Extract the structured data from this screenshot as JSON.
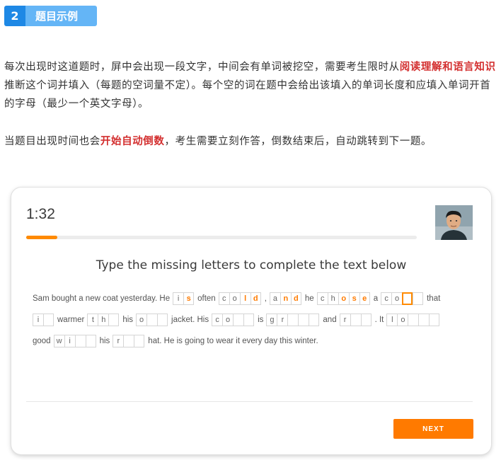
{
  "section": {
    "number": "2",
    "title": "题目示例"
  },
  "para1": {
    "before": "每次出现时这道题时，屏中会出现一段文字，中间会有单词被挖空，需要考生限时从",
    "highlight": "阅读理解和语言知识",
    "after": "推断这个词并填入（每题的空词量不定）。每个空的词在题中会给出该填入的单词长度和应填入单词开首的字母（最少一个英文字母）。"
  },
  "para2": {
    "before": "当题目出现时间也会",
    "highlight": "开始自动倒数",
    "after": "，考生需要立刻作答，倒数结束后，自动跳转到下一题。"
  },
  "colors": {
    "accent": "#ff8a00",
    "highlight": "#d32f2f",
    "badge": "#1e88e5"
  },
  "card": {
    "timer": "1:32",
    "progress_fraction": 0.08,
    "instruction": "Type the missing letters to complete the text below",
    "next_label": "NEXT",
    "lines": [
      [
        {
          "t": "Sam bought a new coat yesterday. He"
        },
        {
          "g": [
            {
              "c": "i",
              "s": "given"
            },
            {
              "c": "s",
              "s": "filled"
            }
          ]
        },
        {
          "t": "often"
        },
        {
          "g": [
            {
              "c": "c",
              "s": "given"
            },
            {
              "c": "o",
              "s": "given"
            },
            {
              "c": "l",
              "s": "filled"
            },
            {
              "c": "d",
              "s": "filled"
            }
          ]
        },
        {
          "t": ","
        },
        {
          "g": [
            {
              "c": "a",
              "s": "given"
            },
            {
              "c": "n",
              "s": "filled"
            },
            {
              "c": "d",
              "s": "filled"
            }
          ]
        },
        {
          "t": "he"
        },
        {
          "g": [
            {
              "c": "c",
              "s": "given"
            },
            {
              "c": "h",
              "s": "given"
            },
            {
              "c": "o",
              "s": "filled"
            },
            {
              "c": "s",
              "s": "filled"
            },
            {
              "c": "e",
              "s": "filled"
            }
          ]
        },
        {
          "t": "a"
        },
        {
          "g": [
            {
              "c": "c",
              "s": "given"
            },
            {
              "c": "o",
              "s": "given"
            },
            {
              "c": "",
              "s": "active"
            },
            {
              "c": "",
              "s": "empty"
            }
          ]
        },
        {
          "t": "that"
        }
      ],
      [
        {
          "g": [
            {
              "c": "i",
              "s": "given"
            },
            {
              "c": "",
              "s": "empty"
            }
          ]
        },
        {
          "t": "warmer"
        },
        {
          "g": [
            {
              "c": "t",
              "s": "given"
            },
            {
              "c": "h",
              "s": "given"
            },
            {
              "c": "",
              "s": "empty"
            }
          ]
        },
        {
          "t": "his"
        },
        {
          "g": [
            {
              "c": "o",
              "s": "given"
            },
            {
              "c": "",
              "s": "empty"
            },
            {
              "c": "",
              "s": "empty"
            }
          ]
        },
        {
          "t": "jacket. His"
        },
        {
          "g": [
            {
              "c": "c",
              "s": "given"
            },
            {
              "c": "o",
              "s": "given"
            },
            {
              "c": "",
              "s": "empty"
            },
            {
              "c": "",
              "s": "empty"
            }
          ]
        },
        {
          "t": "is"
        },
        {
          "g": [
            {
              "c": "g",
              "s": "given"
            },
            {
              "c": "r",
              "s": "given"
            },
            {
              "c": "",
              "s": "empty"
            },
            {
              "c": "",
              "s": "empty"
            },
            {
              "c": "",
              "s": "empty"
            }
          ]
        },
        {
          "t": "and"
        },
        {
          "g": [
            {
              "c": "r",
              "s": "given"
            },
            {
              "c": "",
              "s": "empty"
            },
            {
              "c": "",
              "s": "empty"
            }
          ]
        },
        {
          "t": ". It"
        },
        {
          "g": [
            {
              "c": "l",
              "s": "given"
            },
            {
              "c": "o",
              "s": "given"
            },
            {
              "c": "",
              "s": "empty"
            },
            {
              "c": "",
              "s": "empty"
            },
            {
              "c": "",
              "s": "empty"
            }
          ]
        }
      ],
      [
        {
          "t": "good"
        },
        {
          "g": [
            {
              "c": "w",
              "s": "given"
            },
            {
              "c": "i",
              "s": "given"
            },
            {
              "c": "",
              "s": "empty"
            },
            {
              "c": "",
              "s": "empty"
            }
          ]
        },
        {
          "t": "his"
        },
        {
          "g": [
            {
              "c": "r",
              "s": "given"
            },
            {
              "c": "",
              "s": "empty"
            },
            {
              "c": "",
              "s": "empty"
            }
          ]
        },
        {
          "t": "hat. He is going to wear it every day this winter."
        }
      ]
    ]
  }
}
